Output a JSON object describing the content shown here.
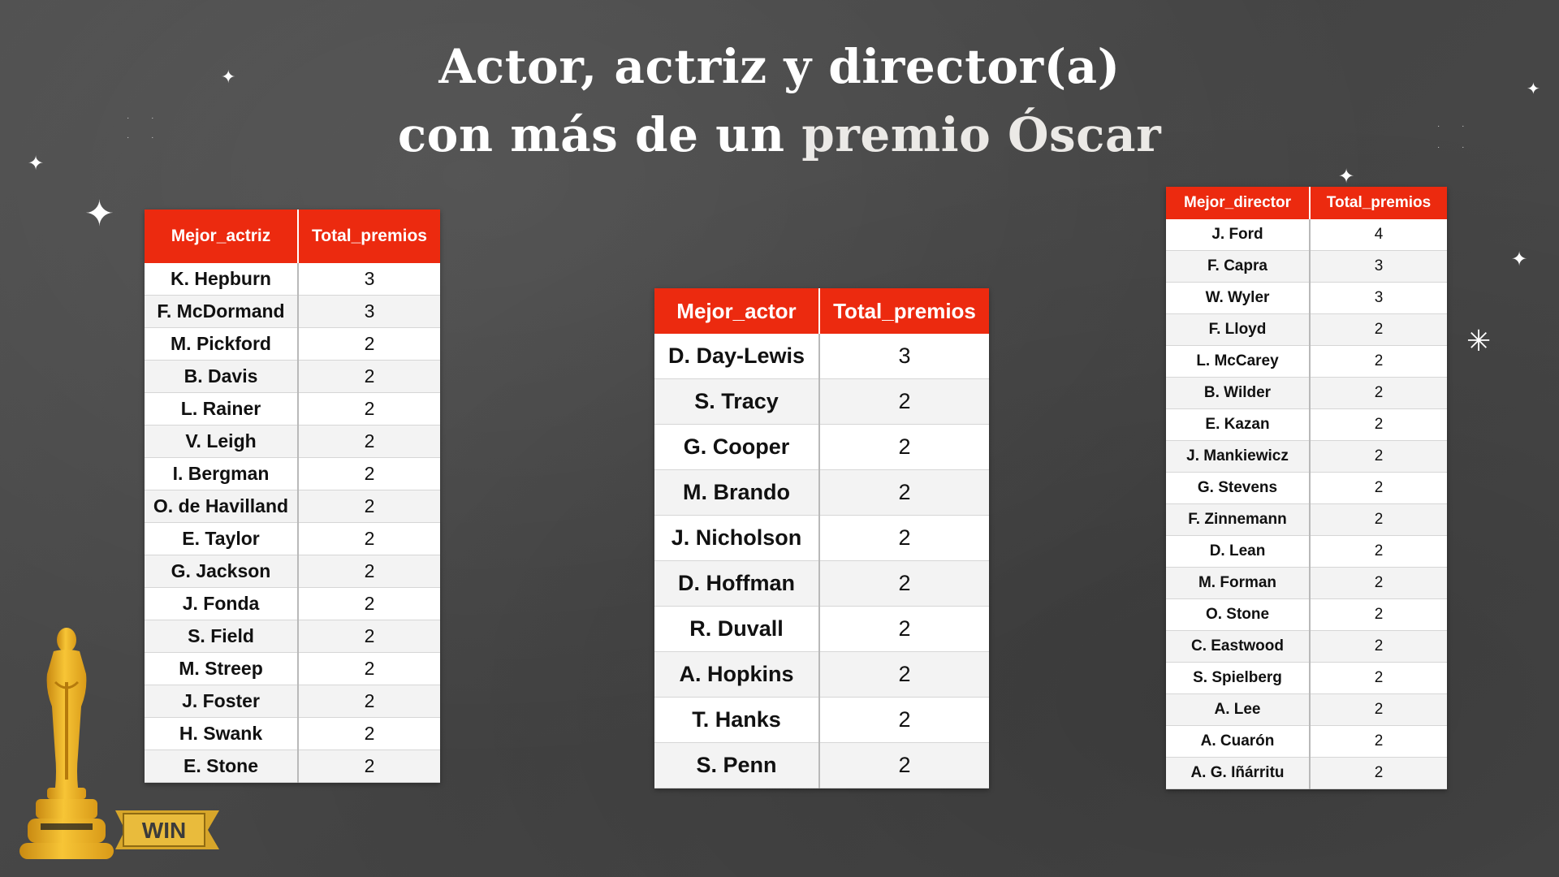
{
  "title": {
    "line1": "Actor, actriz y director(a)",
    "line2_part1": "con más  de un ",
    "line2_part2": "premio Óscar"
  },
  "tables": {
    "actriz": {
      "headers": [
        "Mejor_actriz",
        "Total_premios"
      ],
      "rows": [
        [
          "K. Hepburn",
          "3"
        ],
        [
          "F. McDormand",
          "3"
        ],
        [
          "M. Pickford",
          "2"
        ],
        [
          "B. Davis",
          "2"
        ],
        [
          "L. Rainer",
          "2"
        ],
        [
          "V. Leigh",
          "2"
        ],
        [
          "I. Bergman",
          "2"
        ],
        [
          "O. de Havilland",
          "2"
        ],
        [
          "E. Taylor",
          "2"
        ],
        [
          "G. Jackson",
          "2"
        ],
        [
          "J. Fonda",
          "2"
        ],
        [
          "S. Field",
          "2"
        ],
        [
          "M. Streep",
          "2"
        ],
        [
          "J. Foster",
          "2"
        ],
        [
          "H. Swank",
          "2"
        ],
        [
          "E. Stone",
          "2"
        ]
      ]
    },
    "actor": {
      "headers": [
        "Mejor_actor",
        "Total_premios"
      ],
      "rows": [
        [
          "D. Day-Lewis",
          "3"
        ],
        [
          "S. Tracy",
          "2"
        ],
        [
          "G. Cooper",
          "2"
        ],
        [
          "M. Brando",
          "2"
        ],
        [
          "J. Nicholson",
          "2"
        ],
        [
          "D. Hoffman",
          "2"
        ],
        [
          "R. Duvall",
          "2"
        ],
        [
          "A. Hopkins",
          "2"
        ],
        [
          "T. Hanks",
          "2"
        ],
        [
          "S. Penn",
          "2"
        ]
      ]
    },
    "director": {
      "headers": [
        "Mejor_director",
        "Total_premios"
      ],
      "rows": [
        [
          "J. Ford",
          "4"
        ],
        [
          "F. Capra",
          "3"
        ],
        [
          "W. Wyler",
          "3"
        ],
        [
          "F. Lloyd",
          "2"
        ],
        [
          "L. McCarey",
          "2"
        ],
        [
          "B. Wilder",
          "2"
        ],
        [
          "E. Kazan",
          "2"
        ],
        [
          "J. Mankiewicz",
          "2"
        ],
        [
          "G. Stevens",
          "2"
        ],
        [
          "F. Zinnemann",
          "2"
        ],
        [
          "D. Lean",
          "2"
        ],
        [
          "M. Forman",
          "2"
        ],
        [
          "O. Stone",
          "2"
        ],
        [
          "C. Eastwood",
          "2"
        ],
        [
          "S. Spielberg",
          "2"
        ],
        [
          "A. Lee",
          "2"
        ],
        [
          "A. Cuarón",
          "2"
        ],
        [
          "A. G. Iñárritu",
          "2"
        ]
      ]
    }
  },
  "badge": {
    "label": "WIN"
  },
  "icons": {
    "statuette": "oscar-statuette-icon",
    "sparkle": "sparkle-icon"
  },
  "colors": {
    "header_red": "#ec2a0f",
    "background": "#474747",
    "gold": "#f2b824"
  }
}
